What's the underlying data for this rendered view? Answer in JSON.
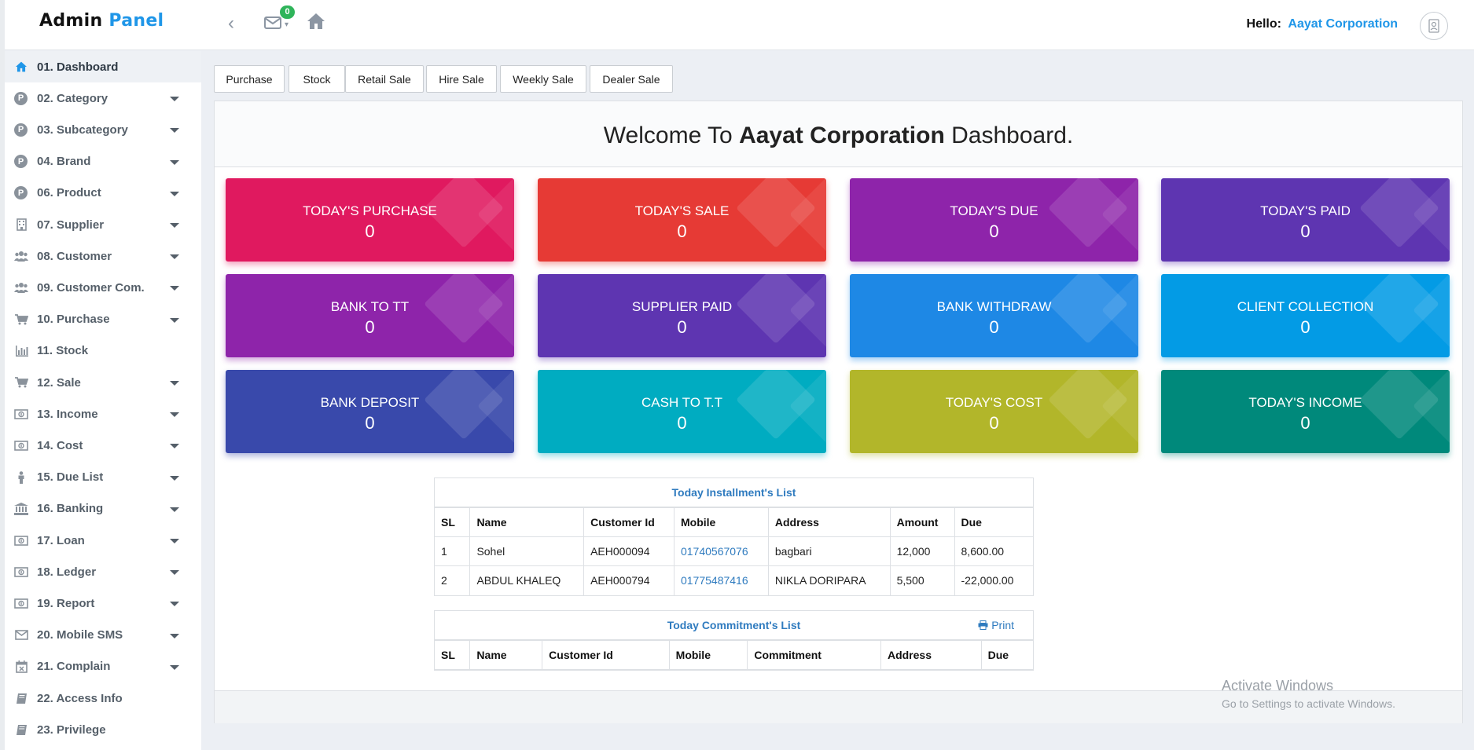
{
  "header": {
    "brand_part1": "Admin",
    "brand_part2": "Panel",
    "mail_badge": "0",
    "hello_label": "Hello:",
    "company": "Aayat Corporation",
    "icons": [
      "chevron-left-icon",
      "envelope-icon",
      "home-icon",
      "avatar-icon"
    ]
  },
  "sidebar": {
    "items": [
      {
        "label": "01. Dashboard",
        "icon": "home-icon",
        "active": true,
        "caret": false
      },
      {
        "label": "02. Category",
        "icon": "p-circle-icon",
        "caret": true
      },
      {
        "label": "03. Subcategory",
        "icon": "p-circle-icon",
        "caret": true
      },
      {
        "label": "04. Brand",
        "icon": "p-circle-icon",
        "caret": true
      },
      {
        "label": "06. Product",
        "icon": "p-circle-icon",
        "caret": true
      },
      {
        "label": "07. Supplier",
        "icon": "building-icon",
        "caret": true
      },
      {
        "label": "08. Customer",
        "icon": "users-icon",
        "caret": true
      },
      {
        "label": "09. Customer Com.",
        "icon": "users-icon",
        "caret": true
      },
      {
        "label": "10. Purchase",
        "icon": "cart-icon",
        "caret": true
      },
      {
        "label": "11. Stock",
        "icon": "bar-chart-icon",
        "caret": false
      },
      {
        "label": "12. Sale",
        "icon": "cart-icon",
        "caret": true
      },
      {
        "label": "13. Income",
        "icon": "money-icon",
        "caret": true
      },
      {
        "label": "14. Cost",
        "icon": "money-icon",
        "caret": true
      },
      {
        "label": "15. Due List",
        "icon": "person-icon",
        "caret": true
      },
      {
        "label": "16. Banking",
        "icon": "bank-icon",
        "caret": true
      },
      {
        "label": "17. Loan",
        "icon": "money-icon",
        "caret": true
      },
      {
        "label": "18. Ledger",
        "icon": "money-icon",
        "caret": true
      },
      {
        "label": "19. Report",
        "icon": "money-icon",
        "caret": true
      },
      {
        "label": "20. Mobile SMS",
        "icon": "envelope-icon",
        "caret": true
      },
      {
        "label": "21. Complain",
        "icon": "calendar-x-icon",
        "caret": true
      },
      {
        "label": "22. Access Info",
        "icon": "book-icon",
        "caret": false
      },
      {
        "label": "23. Privilege",
        "icon": "book-icon",
        "caret": false
      }
    ]
  },
  "toolbar": {
    "buttons": [
      "Purchase",
      "Stock",
      "Retail Sale",
      "Hire Sale",
      "Weekly Sale",
      "Dealer Sale"
    ]
  },
  "main": {
    "welcome_prefix": "Welcome To",
    "welcome_company": "Aayat Corporation",
    "welcome_suffix": "Dashboard.",
    "cards": [
      {
        "title": "TODAY'S PURCHASE",
        "value": "0",
        "color": "#e0195f"
      },
      {
        "title": "TODAY'S SALE",
        "value": "0",
        "color": "#e63a35"
      },
      {
        "title": "TODAY'S DUE",
        "value": "0",
        "color": "#8e24aa"
      },
      {
        "title": "TODAY'S PAID",
        "value": "0",
        "color": "#5e35b1"
      },
      {
        "title": "BANK TO TT",
        "value": "0",
        "color": "#8e24aa"
      },
      {
        "title": "SUPPLIER PAID",
        "value": "0",
        "color": "#5e35b1"
      },
      {
        "title": "BANK WITHDRAW",
        "value": "0",
        "color": "#1e88e5"
      },
      {
        "title": "CLIENT COLLECTION",
        "value": "0",
        "color": "#039be5"
      },
      {
        "title": "BANK DEPOSIT",
        "value": "0",
        "color": "#3949ab"
      },
      {
        "title": "CASH TO T.T",
        "value": "0",
        "color": "#00acc1"
      },
      {
        "title": "TODAY'S COST",
        "value": "0",
        "color": "#b2b62a"
      },
      {
        "title": "TODAY'S INCOME",
        "value": "0",
        "color": "#00897b"
      }
    ]
  },
  "installments": {
    "caption": "Today Installment's List",
    "columns": [
      "SL",
      "Name",
      "Customer Id",
      "Mobile",
      "Address",
      "Amount",
      "Due"
    ],
    "rows": [
      [
        "1",
        "Sohel",
        "AEH000094",
        "01740567076",
        "bagbari",
        "12,000",
        "8,600.00"
      ],
      [
        "2",
        "ABDUL KHALEQ",
        "AEH000794",
        "01775487416",
        "NIKLA DORIPARA",
        "5,500",
        "-22,000.00"
      ]
    ]
  },
  "commitments": {
    "caption": "Today Commitment's List",
    "print_label": "Print",
    "columns": [
      "SL",
      "Name",
      "Customer Id",
      "Mobile",
      "Commitment",
      "Address",
      "Due"
    ]
  },
  "watermark": {
    "line1": "Activate Windows",
    "line2": "Go to Settings to activate Windows."
  }
}
